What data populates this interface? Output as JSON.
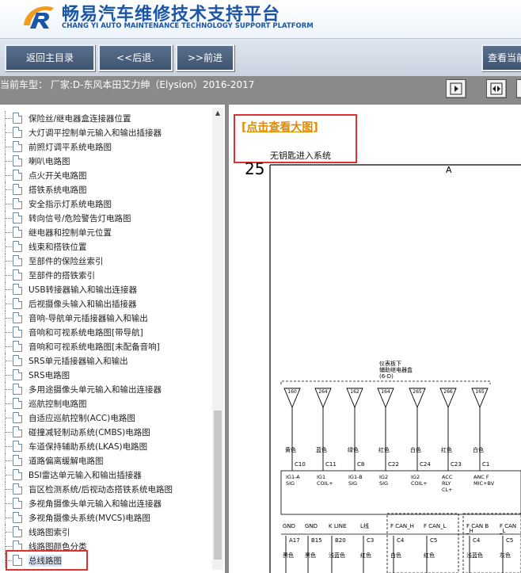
{
  "header": {
    "title_cn": "畅易汽车维修技术支持平台",
    "title_en": "CHANG YI AUTO MAINTENANCE TECHNOLOGY SUPPORT PLATFORM",
    "logo_icon": "cy-logo-icon",
    "brand_color": "#1a55a8"
  },
  "nav": {
    "home_label": "返回主目录",
    "back_label": "<<后退.",
    "forward_label": ">>前进",
    "view_current_label": "查看当前"
  },
  "vehicle": {
    "text": "当前车型：  厂家:D-东风本田艾力绅（Elysion）2016-2017"
  },
  "sidebar": {
    "items": [
      {
        "label": "保险丝/继电器盒连接器位置"
      },
      {
        "label": "大灯调平控制单元输入和输出插接器"
      },
      {
        "label": "前照灯调平系统电路图"
      },
      {
        "label": "喇叭电路图"
      },
      {
        "label": "点火开关电路图"
      },
      {
        "label": "搭铁系统电路图"
      },
      {
        "label": "安全指示灯系统电路图"
      },
      {
        "label": "转向信号/危险警告灯电路图"
      },
      {
        "label": "继电器和控制单元位置"
      },
      {
        "label": "线束和搭铁位置"
      },
      {
        "label": "至部件的保险丝索引"
      },
      {
        "label": "至部件的搭铁索引"
      },
      {
        "label": "USB转接器输入和输出连接器"
      },
      {
        "label": "后视摄像头输入和输出插接器"
      },
      {
        "label": "音响-导航单元插接器输入和输出"
      },
      {
        "label": "音响和可视系统电路图[带导航]"
      },
      {
        "label": "音响和可视系统电路图[未配备音响]"
      },
      {
        "label": "SRS单元插接器输入和输出"
      },
      {
        "label": "SRS电路图"
      },
      {
        "label": "多用途摄像头单元输入和输出连接器"
      },
      {
        "label": "巡航控制电路图"
      },
      {
        "label": "自适应巡航控制(ACC)电路图"
      },
      {
        "label": "碰撞减轻制动系统(CMBS)电路图"
      },
      {
        "label": "车道保持辅助系统(LKAS)电路图"
      },
      {
        "label": "道路偏离缓解电路图"
      },
      {
        "label": "BSI雷达单元输入和输出插接器"
      },
      {
        "label": "盲区检测系统/后视动态搭铁系统电路图"
      },
      {
        "label": "多视角摄像头单元输入和输出连接器"
      },
      {
        "label": "多视角摄像头系统(MVCS)电路图"
      },
      {
        "label": "线路图索引"
      },
      {
        "label": "线路图颜色分类"
      },
      {
        "label": "总线路图"
      }
    ]
  },
  "content": {
    "link_label": "[点击查看大图]",
    "system_name": "无钥匙进入系统"
  },
  "diagram": {
    "page_number": "25",
    "section_letter": "A",
    "junction_note_1": "仪表板下",
    "junction_note_2": "辅助继电器盒",
    "junction_note_3": "(6-D)",
    "fuses": [
      "160",
      "264",
      "162",
      "164",
      "265",
      "266",
      "165"
    ],
    "wire_colors_top": [
      "黄色",
      "蓝色",
      "绿色",
      "红色",
      "白色",
      "红色",
      "白色"
    ],
    "connectors": [
      "C10",
      "C11",
      "C8",
      "C22",
      "C24",
      "C23",
      "C1"
    ],
    "pins_top_1": [
      "IG1-A",
      "IG1",
      "IG1-B",
      "IG2",
      "IG2",
      "ACC",
      "ANC F"
    ],
    "pins_top_2": [
      "SIG",
      "COIL+",
      "SIG",
      "SIG",
      "COIL+",
      "RLY",
      "MIC+BV"
    ],
    "pins_top_3": [
      "",
      "",
      "",
      "",
      "",
      "CL+",
      ""
    ],
    "bottom_signals": [
      "GND",
      "GND",
      "K LINE",
      "L线",
      "F CAN_H",
      "F CAN_L",
      "F CAN B",
      "F CAN"
    ],
    "bottom_signals_2": [
      "",
      "",
      "",
      "",
      "",
      "",
      "_H",
      "_L"
    ],
    "bottom_pins": [
      "A17",
      "B15",
      "B20",
      "C3",
      "C4",
      "C5",
      "C4",
      "C5"
    ],
    "bottom_colors": [
      "黑色",
      "黑色",
      "浅蓝色",
      "红色",
      "白色",
      "红色",
      "浅蓝色",
      "灰色"
    ]
  },
  "colors": {
    "nav_button": "#4a6080",
    "highlight_red": "#e03030",
    "link_orange": "#e08a00",
    "gray_bar": "#8a8a8a"
  }
}
